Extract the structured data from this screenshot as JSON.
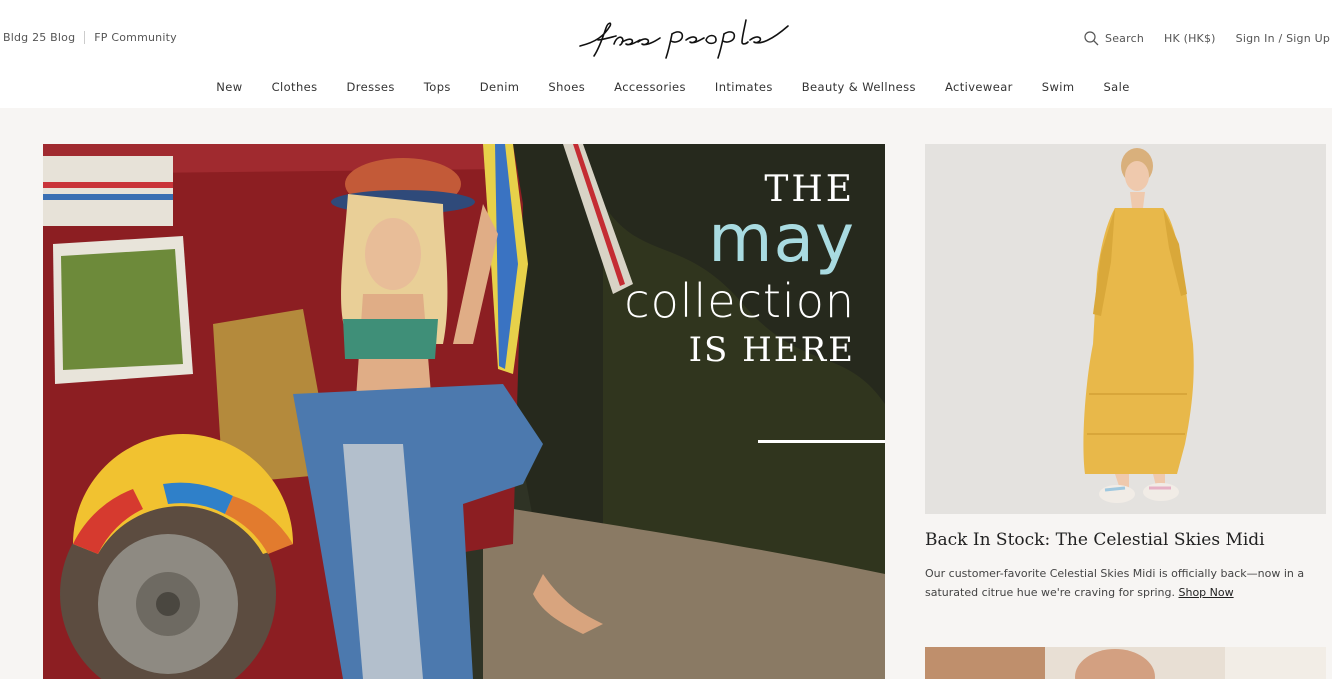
{
  "header": {
    "blog_link": "Bldg 25 Blog",
    "community_link": "FP Community",
    "logo_text": "free people",
    "search_label": "Search",
    "currency_label": "HK (HK$)",
    "signin_label": "Sign In / Sign Up"
  },
  "nav": {
    "items": [
      "New",
      "Clothes",
      "Dresses",
      "Tops",
      "Denim",
      "Shoes",
      "Accessories",
      "Intimates",
      "Beauty & Wellness",
      "Activewear",
      "Swim",
      "Sale"
    ]
  },
  "hero": {
    "line1": "THE",
    "line2": "may",
    "line3": "collection",
    "line4": "IS HERE",
    "accent_color": "#a9dbe1"
  },
  "promo": {
    "title": "Back In Stock: The Celestial Skies Midi",
    "body": "Our customer-favorite Celestial Skies Midi is officially back—now in a saturated citrue hue we're craving for spring.",
    "link": "Shop Now",
    "dress_color": "#e8b84a"
  }
}
